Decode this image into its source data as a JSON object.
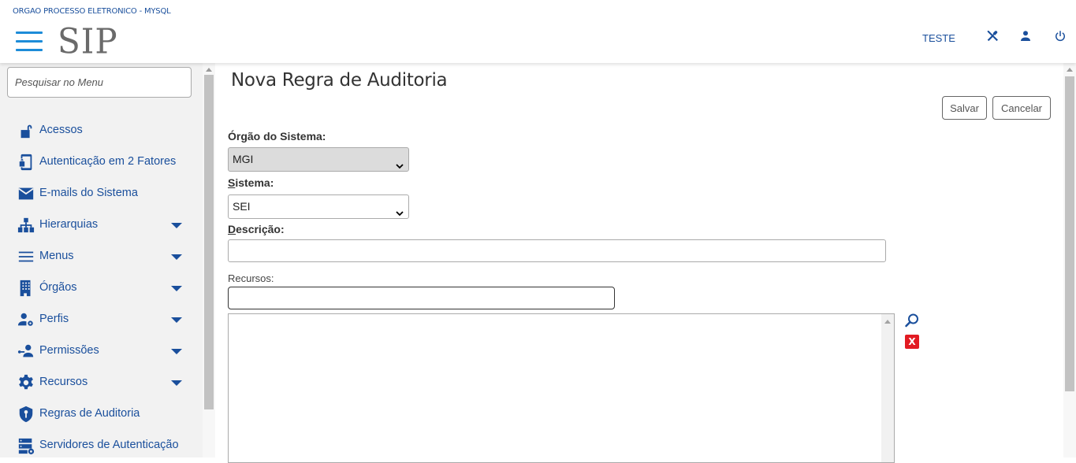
{
  "header": {
    "org_name": "ORGAO PROCESSO ELETRONICO - MYSQL",
    "logo_text": "SIP",
    "user_name": "TESTE",
    "icons": [
      "tools-icon",
      "user-icon",
      "power-icon"
    ],
    "accent_color": "#1a4f9c"
  },
  "sidebar": {
    "search_placeholder": "Pesquisar no Menu",
    "items": [
      {
        "label": "Acessos",
        "icon": "unlock-icon",
        "has_submenu": false
      },
      {
        "label": "Autenticação em 2 Fatores",
        "icon": "phone-lock-icon",
        "has_submenu": false
      },
      {
        "label": "E-mails do Sistema",
        "icon": "envelope-icon",
        "has_submenu": false
      },
      {
        "label": "Hierarquias",
        "icon": "sitemap-icon",
        "has_submenu": true
      },
      {
        "label": "Menus",
        "icon": "list-icon",
        "has_submenu": true
      },
      {
        "label": "Órgãos",
        "icon": "building-icon",
        "has_submenu": true
      },
      {
        "label": "Perfis",
        "icon": "user-gear-icon",
        "has_submenu": true
      },
      {
        "label": "Permissões",
        "icon": "user-key-icon",
        "has_submenu": true
      },
      {
        "label": "Recursos",
        "icon": "gear-icon",
        "has_submenu": true
      },
      {
        "label": "Regras de Auditoria",
        "icon": "shield-key-icon",
        "has_submenu": false
      },
      {
        "label": "Servidores de Autenticação",
        "icon": "server-icon",
        "has_submenu": false
      }
    ]
  },
  "main": {
    "title": "Nova Regra de Auditoria",
    "buttons": {
      "save": "Salvar",
      "cancel": "Cancelar"
    },
    "orgao_label": "Órgão do Sistema:",
    "orgao_value": "MGI",
    "sistema_label_first": "S",
    "sistema_label_rest": "istema:",
    "sistema_value": "SEI",
    "descricao_label_first": "D",
    "descricao_label_rest": "escrição:",
    "descricao_value": "",
    "recursos_label": "Recursos:",
    "recursos_value": "",
    "remove_label": "X"
  }
}
